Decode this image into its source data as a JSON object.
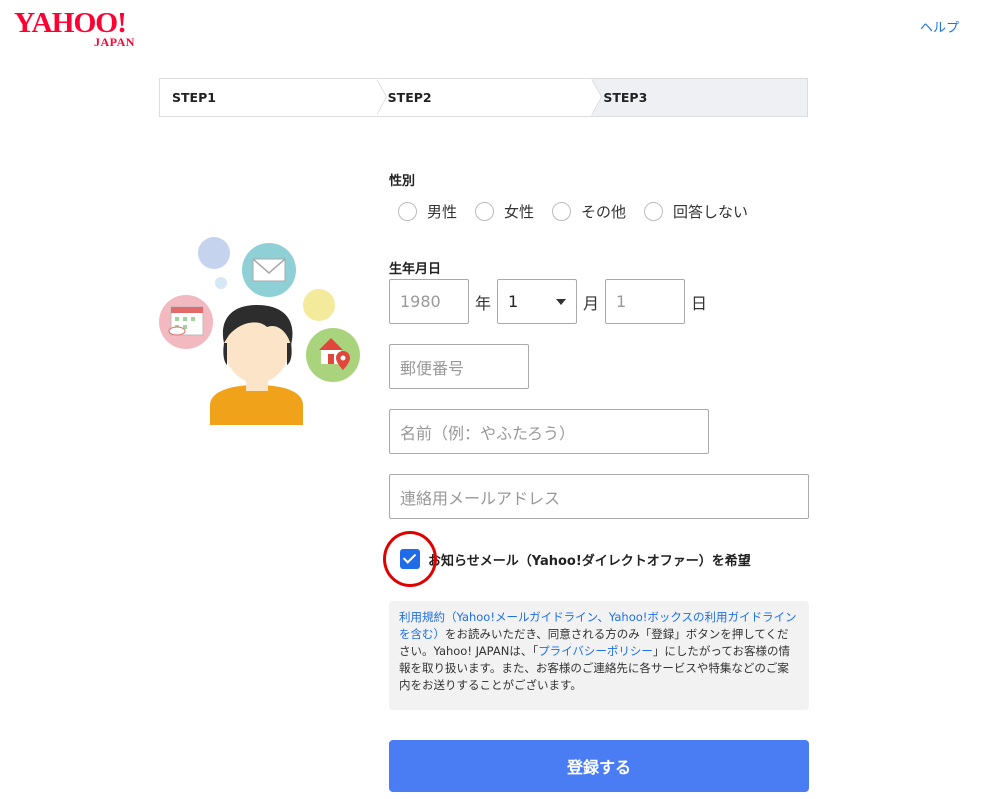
{
  "header": {
    "logo_main": "YAHOO!",
    "logo_sub": "JAPAN",
    "help_label": "ヘルプ"
  },
  "steps": [
    {
      "label": "STEP1",
      "active": false
    },
    {
      "label": "STEP2",
      "active": false
    },
    {
      "label": "STEP3",
      "active": true
    }
  ],
  "form": {
    "gender": {
      "label": "性別",
      "options": [
        "男性",
        "女性",
        "その他",
        "回答しない"
      ]
    },
    "birthdate": {
      "label": "生年月日",
      "year_placeholder": "1980",
      "year_unit": "年",
      "month_value": "1",
      "month_unit": "月",
      "day_placeholder": "1",
      "day_unit": "日"
    },
    "postal_placeholder": "郵便番号",
    "name_placeholder": "名前（例：やふたろう）",
    "email_placeholder": "連絡用メールアドレス",
    "newsletter": {
      "label": "お知らせメール（Yahoo!ダイレクトオファー）を希望",
      "checked": true
    },
    "terms": {
      "link_terms": "利用規約（Yahoo!メールガイドライン、Yahoo!ボックスの利用ガイドラインを含む）",
      "text_1": "をお読みいただき、同意される方のみ「登録」ボタンを押してください。Yahoo! JAPANは、「",
      "link_privacy": "プライバシーポリシー",
      "text_2": "」にしたがってお客様の情報を取り扱います。また、お客様のご連絡先に各サービスや特集などのご案内をお送りすることがございます。"
    },
    "submit_label": "登録する"
  },
  "colors": {
    "brand": "#ff0033",
    "link": "#1e6fe8",
    "primary_button": "#4a7cf3",
    "checkbox": "#1f6be8",
    "annotation": "#e00000"
  }
}
